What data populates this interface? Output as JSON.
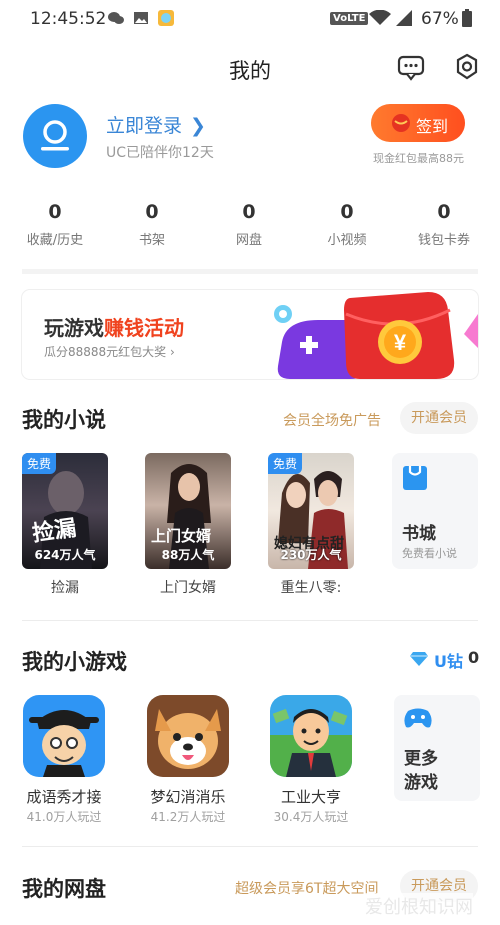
{
  "status": {
    "time": "12:45:52",
    "battery": "67%",
    "volte": "VoLTE"
  },
  "header": {
    "title": "我的"
  },
  "profile": {
    "login": "立即登录",
    "days": "UC已陪伴你12天",
    "sign": "签到",
    "sign_note": "现金红包最高88元"
  },
  "stats": [
    {
      "num": "0",
      "label": "收藏/历史"
    },
    {
      "num": "0",
      "label": "书架"
    },
    {
      "num": "0",
      "label": "网盘"
    },
    {
      "num": "0",
      "label": "小视频"
    },
    {
      "num": "0",
      "label": "钱包卡券"
    }
  ],
  "banner": {
    "title_a": "玩游戏",
    "title_b": "赚钱活动",
    "sub": "瓜分88888元红包大奖",
    "coin": "¥"
  },
  "novels": {
    "title": "我的小说",
    "note": "会员全场免广告",
    "pill": "开通会员",
    "books": [
      {
        "name": "捡漏",
        "tag": "免费",
        "pop": "624万人气",
        "cover_text": "捡漏"
      },
      {
        "name": "上门女婿",
        "tag": "",
        "pop": "88万人气",
        "cover_text": "上门女婿"
      },
      {
        "name": "重生八零:",
        "tag": "免费",
        "pop": "230万人气",
        "cover_text": "媳妇有点甜"
      }
    ],
    "store": {
      "title": "书城",
      "sub": "免费看小说"
    }
  },
  "games": {
    "title": "我的小游戏",
    "ucoin_label": "U钻",
    "ucoin_value": "0",
    "items": [
      {
        "name": "成语秀才接",
        "players": "41.0万人玩过"
      },
      {
        "name": "梦幻消消乐",
        "players": "41.2万人玩过"
      },
      {
        "name": "工业大亨",
        "players": "30.4万人玩过"
      }
    ],
    "more": "更多游戏"
  },
  "disk": {
    "title": "我的网盘",
    "note": "超级会员享6T超大空间",
    "pill": "开通会员"
  },
  "watermark": "爱创根知识网",
  "colors": {
    "accent": "#2b95f0",
    "link": "#3a86d6",
    "sign": "#ff5a22",
    "gold": "#c99a5b"
  }
}
